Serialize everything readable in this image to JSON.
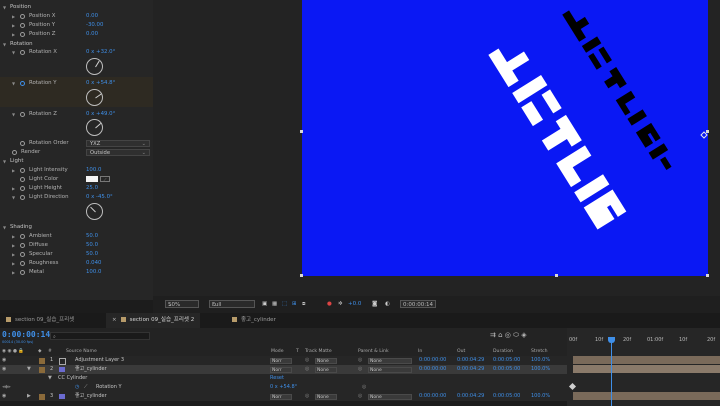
{
  "effect_controls": {
    "position": {
      "label": "Position",
      "x_label": "Position X",
      "x_val": "0.00",
      "y_label": "Position Y",
      "y_val": "-30.00",
      "z_label": "Position Z",
      "z_val": "0.00"
    },
    "rotation": {
      "label": "Rotation",
      "x_label": "Rotation X",
      "x_val": "0 x +32.0°",
      "y_label": "Rotation Y",
      "y_val": "0 x +54.8°",
      "z_label": "Rotation Z",
      "z_val": "0 x +49.0°"
    },
    "rotation_order": {
      "label": "Rotation Order",
      "value": "YXZ"
    },
    "render": {
      "label": "Render",
      "value": "Outside"
    },
    "light": {
      "label": "Light",
      "intensity_label": "Light Intensity",
      "intensity_val": "100.0",
      "color_label": "Light Color",
      "height_label": "Light Height",
      "height_val": "25.0",
      "direction_label": "Light Direction",
      "direction_val": "0 x -45.0°"
    },
    "shading": {
      "label": "Shading",
      "ambient_label": "Ambient",
      "ambient_val": "50.0",
      "diffuse_label": "Diffuse",
      "diffuse_val": "50.0",
      "specular_label": "Specular",
      "specular_val": "50.0",
      "roughness_label": "Roughness",
      "roughness_val": "0.040",
      "metal_label": "Metal",
      "metal_val": "100.0"
    }
  },
  "viewer": {
    "canvas_color": "#0a18f4",
    "text_color": "#ffffff",
    "shadow_color": "#000000",
    "comp_text": "ДЕ ДЕ Я Я",
    "zoom": "50%",
    "resolution": "Full",
    "exposure": "+0.0",
    "time": "0:00:00:14"
  },
  "tabs": [
    {
      "label": "section 09_실습_프리셋"
    },
    {
      "label": "section 09_실습_프리셋 2"
    },
    {
      "label": "좋고_cylinder"
    }
  ],
  "timeline": {
    "current_time": "0:00:00:14",
    "fps": "00014 (30.00 fps)",
    "search_placeholder": "",
    "columns": {
      "source_name": "Source Name",
      "mode": "Mode",
      "t": "T",
      "track_matte": "Track Matte",
      "parent": "Parent & Link",
      "in": "In",
      "out": "Out",
      "duration": "Duration",
      "stretch": "Stretch"
    },
    "layers": [
      {
        "num": "1",
        "name": "Adjustment Layer 3",
        "mode": "Norr",
        "matte": "None",
        "parent": "None",
        "in": "0:00:00:00",
        "out": "0:00:04:29",
        "duration": "0:00:05:00",
        "stretch": "100.0%",
        "color": "#8a6a3a"
      },
      {
        "num": "2",
        "name": "좋고_cylinder",
        "mode": "Norr",
        "matte": "None",
        "parent": "None",
        "in": "0:00:00:00",
        "out": "0:00:04:29",
        "duration": "0:00:05:00",
        "stretch": "100.0%",
        "color": "#8a6a3a"
      },
      {
        "num": "3",
        "name": "좋고_cylinder",
        "mode": "Norr",
        "matte": "None",
        "parent": "None",
        "in": "0:00:00:00",
        "out": "0:00:04:29",
        "duration": "0:00:05:00",
        "stretch": "100.0%",
        "color": "#8a6a3a"
      }
    ],
    "effect_row": {
      "label": "CC Cylinder",
      "reset": "Reset"
    },
    "prop_row": {
      "label": "Rotation Y",
      "value": "0 x +54.8°"
    },
    "ruler": [
      "00f",
      "10f",
      "20f",
      "01:00f",
      "10f",
      "20f"
    ]
  }
}
